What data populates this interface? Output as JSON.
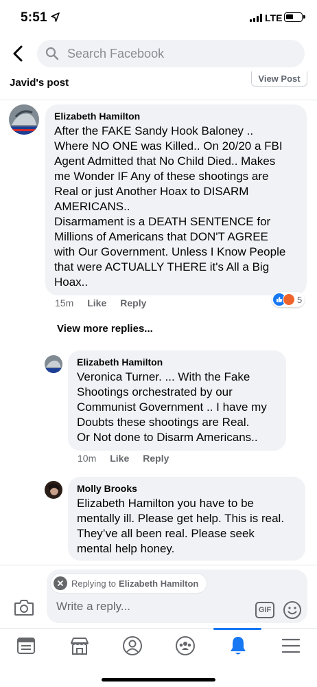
{
  "status_bar": {
    "time": "5:51",
    "network": "LTE"
  },
  "header": {
    "search_placeholder": "Search Facebook"
  },
  "post_context": {
    "title": "Javid's post",
    "view_post_label": "View Post"
  },
  "comments": [
    {
      "author": "Elizabeth Hamilton",
      "text": "After the FAKE Sandy Hook Baloney ..\nWhere NO ONE was Killed.. On 20/20 a FBI\nAgent Admitted that No Child Died.. Makes\nme Wonder IF Any of these shootings are\nReal or just Another Hoax to DISARM\nAMERICANS..\nDisarmament is a DEATH SENTENCE for\nMillions of Americans that DON'T AGREE\nwith Our Government. Unless I Know People\nthat were ACTUALLY THERE it's All a Big\nHoax..",
      "time": "15m",
      "like_label": "Like",
      "reply_label": "Reply",
      "reaction_count": "5",
      "reactions": [
        "like-icon",
        "angry-icon"
      ]
    }
  ],
  "view_more_replies": "View more replies...",
  "replies": [
    {
      "author": "Elizabeth Hamilton",
      "text": "Veronica Turner. ... With the Fake\nShootings orchestrated by our\nCommunist Government .. I have my\nDoubts these shootings are Real.\nOr Not done to Disarm Americans..",
      "time": "10m",
      "like_label": "Like",
      "reply_label": "Reply"
    },
    {
      "author": "Molly Brooks",
      "text": "Elizabeth Hamilton you have to be\nmentally ill. Please get help. This is real.\nThey’ve all been real. Please seek\nmental help honey."
    }
  ],
  "composer": {
    "replying_prefix": "Replying to",
    "replying_name": "Elizabeth Hamilton",
    "placeholder": "Write a reply...",
    "gif_label": "GIF"
  },
  "bottom_nav": [
    {
      "icon": "news-feed-icon",
      "active": false
    },
    {
      "icon": "marketplace-icon",
      "active": false
    },
    {
      "icon": "profile-icon",
      "active": false
    },
    {
      "icon": "groups-icon",
      "active": false
    },
    {
      "icon": "notifications-bell-icon",
      "active": true
    },
    {
      "icon": "menu-icon",
      "active": false
    }
  ],
  "colors": {
    "accent": "#1877f2",
    "bubble": "#f0f2f5",
    "meta_text": "#65676b"
  }
}
